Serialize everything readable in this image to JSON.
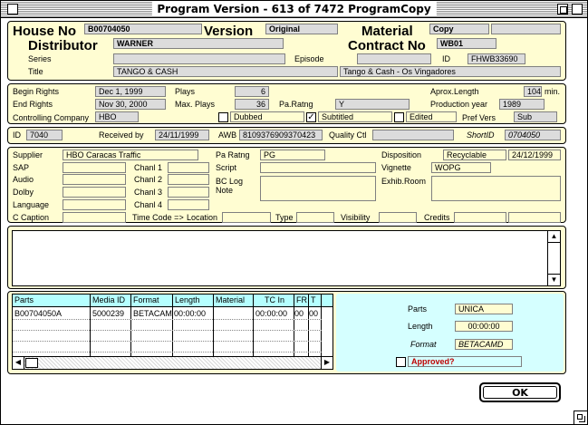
{
  "window": {
    "title": "Program Version - 613 of 7472 ProgramCopy"
  },
  "header": {
    "house_no_label": "House No",
    "house_no": "B00704050",
    "version_label": "Version",
    "version": "Original",
    "material_label": "Material",
    "material": "Copy",
    "distributor_label": "Distributor",
    "distributor": "WARNER",
    "contract_no_label": "Contract No",
    "contract_no": "WB01",
    "series_label": "Series",
    "series": "",
    "episode_label": "Episode",
    "episode": "",
    "id_label": "ID",
    "id": "FHWB33690",
    "title_label": "Title",
    "title": "TANGO & CASH",
    "title_local": "Tango & Cash - Os Vingadores"
  },
  "rights": {
    "begin_label": "Begin Rights",
    "begin": "Dec 1, 1999",
    "plays_label": "Plays",
    "plays": "6",
    "aprox_length_label": "Aprox.Length",
    "aprox_length": "104",
    "min_label": "min.",
    "end_label": "End Rights",
    "end": "Nov 30, 2000",
    "max_plays_label": "Max. Plays",
    "max_plays": "36",
    "pa_ratng_label": "Pa.Ratng",
    "pa_ratng": "Y",
    "production_year_label": "Production year",
    "production_year": "1989",
    "controlling_company_label": "Controlling Company",
    "controlling_company": "HBO",
    "dubbed_label": "Dubbed",
    "dubbed_checked": "",
    "subtitled_label": "Subtitled",
    "subtitled_checked": "✓",
    "edited_label": "Edited",
    "edited_checked": "",
    "pref_vers_label": "Pref Vers",
    "pref_vers": "Sub"
  },
  "receipt": {
    "id_label": "ID",
    "id": "7040",
    "received_by_label": "Received by",
    "received_by": "24/11/1999",
    "awb_label": "AWB",
    "awb": "8109376909370423",
    "quality_ctl_label": "Quality Ctl",
    "quality_ctl": "",
    "short_id_label": "ShortID",
    "short_id": "0704050"
  },
  "tech": {
    "supplier_label": "Supplier",
    "supplier": "HBO Caracas Traffic",
    "pa_ratng_label": "Pa Ratng",
    "pa_ratng": "PG",
    "disposition_label": "Disposition",
    "disposition": "Recyclable",
    "disposition_date": "24/12/1999",
    "sap_label": "SAP",
    "chanl1_label": "Chanl 1",
    "script_label": "Script",
    "vignette_label": "Vignette",
    "vignette": "WOPG",
    "audio_label": "Audio",
    "chanl2_label": "Chanl 2",
    "bc_log_label": "BC Log",
    "note_label": "Note",
    "exhib_room_label": "Exhib.Room",
    "dolby_label": "Dolby",
    "chanl3_label": "Chanl 3",
    "language_label": "Language",
    "chanl4_label": "Chanl 4",
    "c_caption_label": "C Caption",
    "time_code_label": "Time Code =>",
    "location_label": "Location",
    "type_label": "Type",
    "visibility_label": "Visibility",
    "credits_label": "Credits"
  },
  "parts_table": {
    "columns": [
      "Parts",
      "Media ID",
      "Format",
      "Length",
      "Material",
      "TC In",
      "FR",
      "T"
    ],
    "rows": [
      [
        "B00704050A",
        "5000239",
        "BETACAM",
        "00:00:00",
        "",
        "00:00:00",
        "00",
        "00"
      ]
    ]
  },
  "part_detail": {
    "parts_label": "Parts",
    "parts": "UNICA",
    "length_label": "Length",
    "length": "00:00:00",
    "format_label": "Format",
    "format": "BETACAMD",
    "approved_label": "Approved?"
  },
  "footer": {
    "ok_label": "OK"
  },
  "colors": {
    "panel": "#fffdd2",
    "approved_panel": "#d5ffff",
    "table_header": "#b5ffff",
    "approved_text": "#c00000"
  }
}
